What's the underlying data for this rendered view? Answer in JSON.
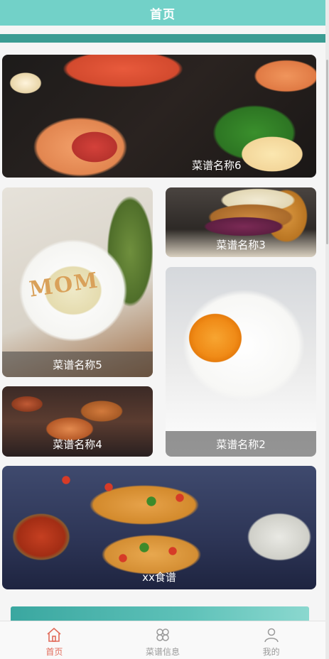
{
  "header": {
    "title": "首页"
  },
  "recipes": [
    {
      "name": "菜谱名称6",
      "image": "seafood-platter"
    },
    {
      "name": "菜谱名称5",
      "image": "mom-soup"
    },
    {
      "name": "菜谱名称3",
      "image": "burger"
    },
    {
      "name": "菜谱名称2",
      "image": "fried-egg"
    },
    {
      "name": "菜谱名称4",
      "image": "buffet"
    },
    {
      "name": "xx食谱",
      "image": "pizza-bread"
    }
  ],
  "soup_decor_text": "MOM",
  "tabbar": {
    "items": [
      {
        "label": "首页",
        "icon": "home-icon",
        "active": true
      },
      {
        "label": "菜谱信息",
        "icon": "grid-flower-icon",
        "active": false
      },
      {
        "label": "我的",
        "icon": "user-icon",
        "active": false
      }
    ]
  },
  "colors": {
    "header": "#72d1c8",
    "band": "#3b9c93",
    "tab_active": "#e16b5a",
    "tab_inactive": "#9a9a9a"
  }
}
